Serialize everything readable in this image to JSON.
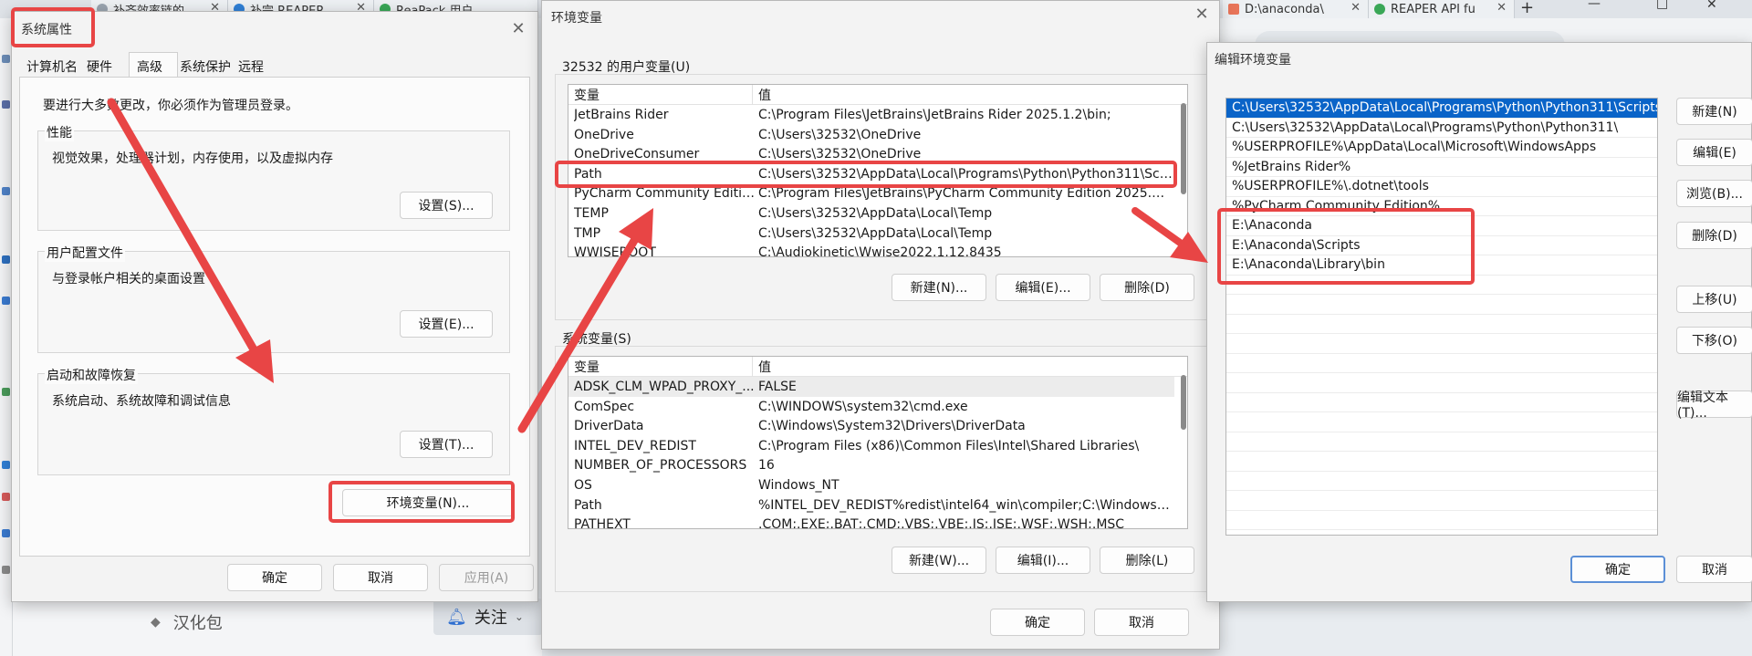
{
  "browser": {
    "tabs": [
      {
        "label": "补齐效率链的",
        "icon": "search-icon"
      },
      {
        "label": "补完 REAPER",
        "icon": "edge-icon"
      },
      {
        "label": "ReaPack 用户",
        "icon": "chrome-icon"
      },
      {
        "label": "D:\\anaconda\\",
        "icon": "app-c-icon"
      },
      {
        "label": "REAPER API fu",
        "icon": "chrome-icon"
      }
    ],
    "new_tab": "+",
    "window_controls": {
      "minimize": "—",
      "maximize": "□",
      "close": "✕"
    },
    "bottom_tag_label": "汉化包",
    "follow_label": "关注"
  },
  "sysprops": {
    "title": "系统属性",
    "close": "✕",
    "tabs": [
      "计算机名",
      "硬件",
      "高级",
      "系统保护",
      "远程"
    ],
    "active_tab": "高级",
    "admin_note": "要进行大多数更改，你必须作为管理员登录。",
    "performance": {
      "title": "性能",
      "desc": "视觉效果，处理器计划，内存使用，以及虚拟内存",
      "button": "设置(S)..."
    },
    "profiles": {
      "title": "用户配置文件",
      "desc": "与登录帐户相关的桌面设置",
      "button": "设置(E)..."
    },
    "startup": {
      "title": "启动和故障恢复",
      "desc": "系统启动、系统故障和调试信息",
      "button": "设置(T)..."
    },
    "env_button": "环境变量(N)...",
    "ok": "确定",
    "cancel": "取消",
    "apply": "应用(A)"
  },
  "envvars": {
    "title": "环境变量",
    "close": "✕",
    "user_section": "32532 的用户变量(U)",
    "col_var": "变量",
    "col_val": "值",
    "user_rows": [
      {
        "name": "JetBrains Rider",
        "value": "C:\\Program Files\\JetBrains\\JetBrains Rider 2025.1.2\\bin;"
      },
      {
        "name": "OneDrive",
        "value": "C:\\Users\\32532\\OneDrive"
      },
      {
        "name": "OneDriveConsumer",
        "value": "C:\\Users\\32532\\OneDrive"
      },
      {
        "name": "Path",
        "value": "C:\\Users\\32532\\AppData\\Local\\Programs\\Python\\Python311\\Scri..."
      },
      {
        "name": "PyCharm Community Edition",
        "value": "C:\\Program Files\\JetBrains\\PyCharm Community Edition 2025.1.1...."
      },
      {
        "name": "TEMP",
        "value": "C:\\Users\\32532\\AppData\\Local\\Temp"
      },
      {
        "name": "TMP",
        "value": "C:\\Users\\32532\\AppData\\Local\\Temp"
      },
      {
        "name": "WWISEROOT",
        "value": "C:\\Audiokinetic\\Wwise2022.1.12.8435"
      }
    ],
    "user_new": "新建(N)...",
    "user_edit": "编辑(E)...",
    "user_delete": "删除(D)",
    "sys_section": "系统变量(S)",
    "sys_rows": [
      {
        "name": "ADSK_CLM_WPAD_PROXY_...",
        "value": "FALSE"
      },
      {
        "name": "ComSpec",
        "value": "C:\\WINDOWS\\system32\\cmd.exe"
      },
      {
        "name": "DriverData",
        "value": "C:\\Windows\\System32\\Drivers\\DriverData"
      },
      {
        "name": "INTEL_DEV_REDIST",
        "value": "C:\\Program Files (x86)\\Common Files\\Intel\\Shared Libraries\\"
      },
      {
        "name": "NUMBER_OF_PROCESSORS",
        "value": "16"
      },
      {
        "name": "OS",
        "value": "Windows_NT"
      },
      {
        "name": "Path",
        "value": "%INTEL_DEV_REDIST%redist\\intel64_win\\compiler;C:\\Windows\\sys..."
      },
      {
        "name": "PATHEXT",
        "value": ".COM;.EXE;.BAT;.CMD;.VBS;.VBE;.JS;.JSE;.WSF;.WSH;.MSC"
      }
    ],
    "sys_new": "新建(W)...",
    "sys_edit": "编辑(I)...",
    "sys_delete": "删除(L)",
    "ok": "确定",
    "cancel": "取消"
  },
  "editenv": {
    "title": "编辑环境变量",
    "entries": [
      "C:\\Users\\32532\\AppData\\Local\\Programs\\Python\\Python311\\Scripts\\",
      "C:\\Users\\32532\\AppData\\Local\\Programs\\Python\\Python311\\",
      "%USERPROFILE%\\AppData\\Local\\Microsoft\\WindowsApps",
      "%JetBrains Rider%",
      "%USERPROFILE%\\.dotnet\\tools",
      "%PyCharm Community Edition%",
      "E:\\Anaconda",
      "E:\\Anaconda\\Scripts",
      "E:\\Anaconda\\Library\\bin"
    ],
    "new": "新建(N)",
    "edit": "编辑(E)",
    "browse": "浏览(B)...",
    "delete": "删除(D)",
    "up": "上移(U)",
    "down": "下移(O)",
    "edit_text": "编辑文本(T)...",
    "ok": "确定",
    "cancel": "取消"
  },
  "colors": {
    "annotation_red": "#e84545",
    "selection_blue": "#0a64c8",
    "dialog_bg": "#f3f3f3"
  }
}
